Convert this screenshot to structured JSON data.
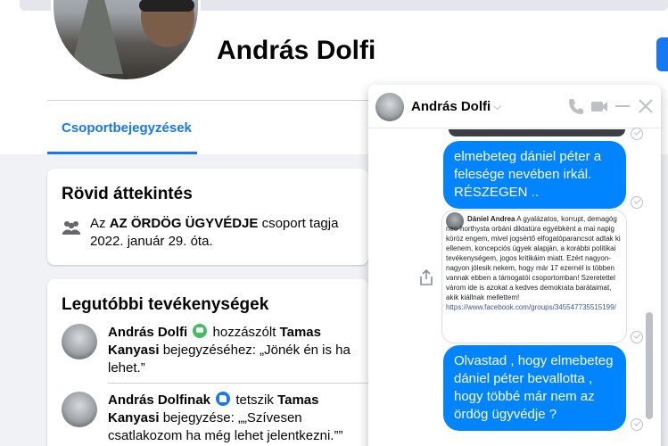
{
  "profile": {
    "name": "András Dolfi"
  },
  "tabs": [
    {
      "label": "Csoportbejegyzések",
      "active": true
    }
  ],
  "overview": {
    "title": "Rövid áttekintés",
    "prefix": "Az",
    "group": "AZ ÖRDÖG ÜGYVÉDJE",
    "suffix": "csoport tagja",
    "since": "2022. január 29. óta."
  },
  "activity": {
    "title": "Legutóbbi tevékenységek",
    "items": [
      {
        "actor": "András Dolfi",
        "icon": "comment-icon",
        "verb": "hozzászólt",
        "target": "Tamas Kanyasi",
        "rest": "bejegyzéséhez: „Jönék én is ha lehet.”"
      },
      {
        "actor": "András Dolfinak",
        "icon": "like-icon",
        "verb": "tetszik",
        "target": "Tamas Kanyasi",
        "rest": "bejegyzése: „„Szívesen csatlakozom ha még lehet jelentkezni.””"
      }
    ]
  },
  "chat": {
    "name": "András Dolfi",
    "messages": [
      {
        "type": "text",
        "text": "elmebeteg dániel péter a felesége nevében irkál. RÉSZEGEN .."
      },
      {
        "type": "screenshot",
        "author": "Dániel Andrea",
        "body": "A gyalázatos, korrupt, demagóg neo-horthysta orbáni diktatúra egyébként a mai napig köröz engem, mivel jogsértő elfogatóparancsot adtak ki ellenem, koncepciós ügyek alapján, a korábbi politikai tevékenységem, jogos kritikáim miatt. Ezért nagyon-nagyon jólesik nekem, hogy már 17 ezernél is többen vannak ebben a támogatói csoportomban! Szeretettel várom ide is azokat a kedves demokrata barátaimat, akik kiállnak mellettem!",
        "link": "https://www.facebook.com/groups/345547735515199/"
      },
      {
        "type": "text",
        "text": "Olvastad , hogy elmebeteg dániel péter bevallotta , hogy többé már nem az ördög ügyvédje ?"
      }
    ]
  },
  "colors": {
    "accent": "#1877f2",
    "messenger_blue": "#0084ff",
    "background": "#f0f2f5"
  }
}
